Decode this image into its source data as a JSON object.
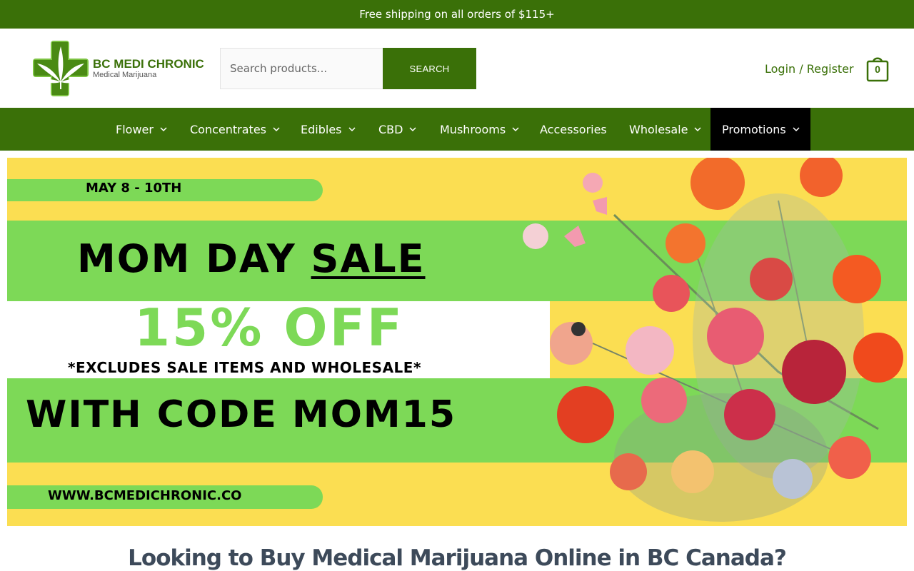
{
  "topbar": {
    "text": "Free shipping on all orders of $115+"
  },
  "logo": {
    "title": "BC MEDI CHRONIC",
    "subtitle": "Medical Marijuana"
  },
  "search": {
    "placeholder": "Search products...",
    "button_label": "SEARCH"
  },
  "account": {
    "login_label": "Login / Register"
  },
  "cart": {
    "count": "0"
  },
  "nav": {
    "items": [
      {
        "label": "Flower",
        "has_dropdown": true
      },
      {
        "label": "Concentrates",
        "has_dropdown": true
      },
      {
        "label": "Edibles",
        "has_dropdown": true
      },
      {
        "label": "CBD",
        "has_dropdown": true
      },
      {
        "label": "Mushrooms",
        "has_dropdown": true
      },
      {
        "label": "Accessories",
        "has_dropdown": false
      },
      {
        "label": "Wholesale",
        "has_dropdown": true
      },
      {
        "label": "Promotions",
        "has_dropdown": true,
        "active": true
      }
    ]
  },
  "banner": {
    "dates": "MAY 8 - 10TH",
    "headline_main": "MOM DAY ",
    "headline_underlined": "SALE",
    "discount": "15% OFF",
    "exclusion": "*EXCLUDES SALE ITEMS AND WHOLESALE*",
    "code_line": "WITH CODE MOM15",
    "website": "WWW.BCMEDICHRONIC.CO",
    "colors": {
      "yellow": "#fbde52",
      "green": "#7dd957",
      "discount_text": "#7dd957"
    }
  },
  "main": {
    "heading": "Looking to Buy Medical Marijuana Online in BC Canada?"
  },
  "theme": {
    "brand_green": "#3a7008",
    "active_nav_bg": "#000000",
    "heading_color": "#3d4a5a"
  }
}
